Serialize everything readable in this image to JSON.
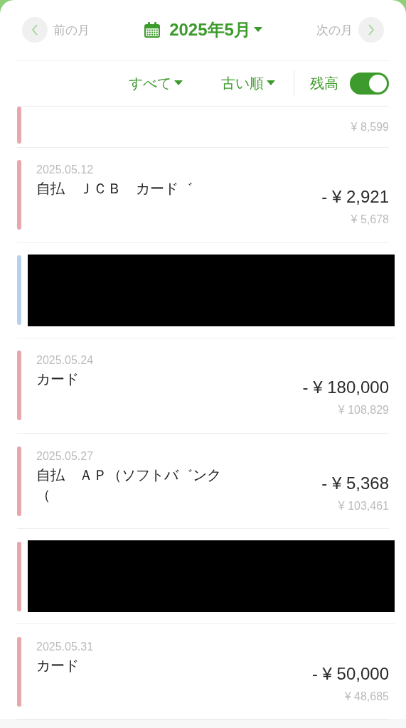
{
  "header": {
    "prev_label": "前の月",
    "month": "2025年5月",
    "next_label": "次の月"
  },
  "filters": {
    "category": "すべて",
    "order": "古い順",
    "balance_label": "残高",
    "balance_on": true
  },
  "transactions": [
    {
      "kind": "partial",
      "color": "#e8a6ae",
      "balance": "¥ 8,599"
    },
    {
      "kind": "entry",
      "color": "#e8a6ae",
      "date": "2025.05.12",
      "name": "自払　ＪＣＢ　カード゛",
      "amount": "- ¥ 2,921",
      "balance": "¥ 5,678"
    },
    {
      "kind": "redacted",
      "color": "#b4d2ee"
    },
    {
      "kind": "entry",
      "color": "#e8a6ae",
      "date": "2025.05.24",
      "name": "カード",
      "amount": "- ¥ 180,000",
      "balance": "¥ 108,829"
    },
    {
      "kind": "entry",
      "color": "#e8a6ae",
      "date": "2025.05.27",
      "name": "自払　ＡＰ（ソフトバ゛ンク（",
      "amount": "- ¥ 5,368",
      "balance": "¥ 103,461"
    },
    {
      "kind": "redacted",
      "color": "#e8a6ae"
    },
    {
      "kind": "entry",
      "color": "#e8a6ae",
      "date": "2025.05.31",
      "name": "カード",
      "amount": "- ¥ 50,000",
      "balance": "¥ 48,685"
    }
  ]
}
